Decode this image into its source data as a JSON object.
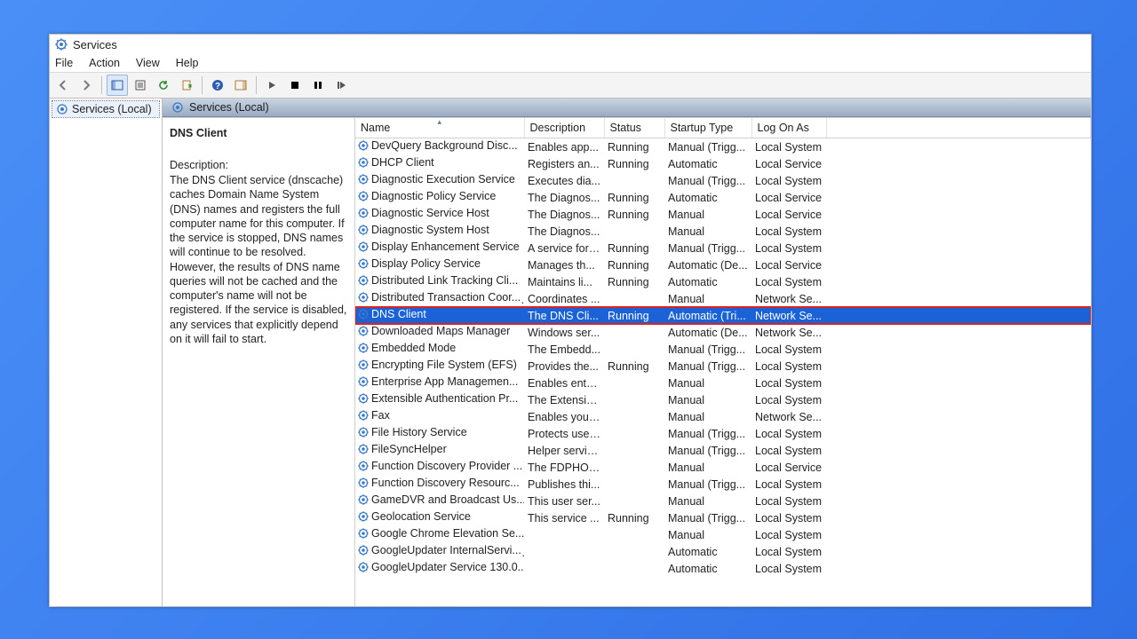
{
  "window": {
    "title": "Services"
  },
  "menu": {
    "file": "File",
    "action": "Action",
    "view": "View",
    "help": "Help"
  },
  "tree": {
    "root": "Services (Local)"
  },
  "tab": {
    "label": "Services (Local)"
  },
  "detail": {
    "service_name": "DNS Client",
    "description_label": "Description:",
    "description": "The DNS Client service (dnscache) caches Domain Name System (DNS) names and registers the full computer name for this computer. If the service is stopped, DNS names will continue to be resolved. However, the results of DNS name queries will not be cached and the computer's name will not be registered. If the service is disabled, any services that explicitly depend on it will fail to start."
  },
  "columns": {
    "name": "Name",
    "description": "Description",
    "status": "Status",
    "startup_type": "Startup Type",
    "log_on_as": "Log On As"
  },
  "rows": [
    {
      "name": "DevQuery Background Disc...",
      "description": "Enables app...",
      "status": "Running",
      "startup": "Manual (Trigg...",
      "logon": "Local System"
    },
    {
      "name": "DHCP Client",
      "description": "Registers an...",
      "status": "Running",
      "startup": "Automatic",
      "logon": "Local Service"
    },
    {
      "name": "Diagnostic Execution Service",
      "description": "Executes dia...",
      "status": "",
      "startup": "Manual (Trigg...",
      "logon": "Local System"
    },
    {
      "name": "Diagnostic Policy Service",
      "description": "The Diagnos...",
      "status": "Running",
      "startup": "Automatic",
      "logon": "Local Service"
    },
    {
      "name": "Diagnostic Service Host",
      "description": "The Diagnos...",
      "status": "Running",
      "startup": "Manual",
      "logon": "Local Service"
    },
    {
      "name": "Diagnostic System Host",
      "description": "The Diagnos...",
      "status": "",
      "startup": "Manual",
      "logon": "Local System"
    },
    {
      "name": "Display Enhancement Service",
      "description": "A service for ...",
      "status": "Running",
      "startup": "Manual (Trigg...",
      "logon": "Local System"
    },
    {
      "name": "Display Policy Service",
      "description": "Manages th...",
      "status": "Running",
      "startup": "Automatic (De...",
      "logon": "Local Service"
    },
    {
      "name": "Distributed Link Tracking Cli...",
      "description": "Maintains li...",
      "status": "Running",
      "startup": "Automatic",
      "logon": "Local System"
    },
    {
      "name": "Distributed Transaction Coor...",
      "description": "Coordinates ...",
      "status": "",
      "startup": "Manual",
      "logon": "Network Se..."
    },
    {
      "name": "DNS Client",
      "description": "The DNS Cli...",
      "status": "Running",
      "startup": "Automatic (Tri...",
      "logon": "Network Se...",
      "selected": true,
      "highlighted": true
    },
    {
      "name": "Downloaded Maps Manager",
      "description": "Windows ser...",
      "status": "",
      "startup": "Automatic (De...",
      "logon": "Network Se..."
    },
    {
      "name": "Embedded Mode",
      "description": "The Embedd...",
      "status": "",
      "startup": "Manual (Trigg...",
      "logon": "Local System"
    },
    {
      "name": "Encrypting File System (EFS)",
      "description": "Provides the...",
      "status": "Running",
      "startup": "Manual (Trigg...",
      "logon": "Local System"
    },
    {
      "name": "Enterprise App Managemen...",
      "description": "Enables ente...",
      "status": "",
      "startup": "Manual",
      "logon": "Local System"
    },
    {
      "name": "Extensible Authentication Pr...",
      "description": "The Extensib...",
      "status": "",
      "startup": "Manual",
      "logon": "Local System"
    },
    {
      "name": "Fax",
      "description": "Enables you ...",
      "status": "",
      "startup": "Manual",
      "logon": "Network Se..."
    },
    {
      "name": "File History Service",
      "description": "Protects user...",
      "status": "",
      "startup": "Manual (Trigg...",
      "logon": "Local System"
    },
    {
      "name": "FileSyncHelper",
      "description": "Helper servic...",
      "status": "",
      "startup": "Manual (Trigg...",
      "logon": "Local System"
    },
    {
      "name": "Function Discovery Provider ...",
      "description": "The FDPHOS...",
      "status": "",
      "startup": "Manual",
      "logon": "Local Service"
    },
    {
      "name": "Function Discovery Resourc...",
      "description": "Publishes thi...",
      "status": "",
      "startup": "Manual (Trigg...",
      "logon": "Local System"
    },
    {
      "name": "GameDVR and Broadcast Us...",
      "description": "This user ser...",
      "status": "",
      "startup": "Manual",
      "logon": "Local System"
    },
    {
      "name": "Geolocation Service",
      "description": "This service ...",
      "status": "Running",
      "startup": "Manual (Trigg...",
      "logon": "Local System"
    },
    {
      "name": "Google Chrome Elevation Se...",
      "description": "",
      "status": "",
      "startup": "Manual",
      "logon": "Local System"
    },
    {
      "name": "GoogleUpdater InternalServi...",
      "description": "",
      "status": "",
      "startup": "Automatic",
      "logon": "Local System"
    },
    {
      "name": "GoogleUpdater Service 130.0...",
      "description": "",
      "status": "",
      "startup": "Automatic",
      "logon": "Local System"
    }
  ]
}
